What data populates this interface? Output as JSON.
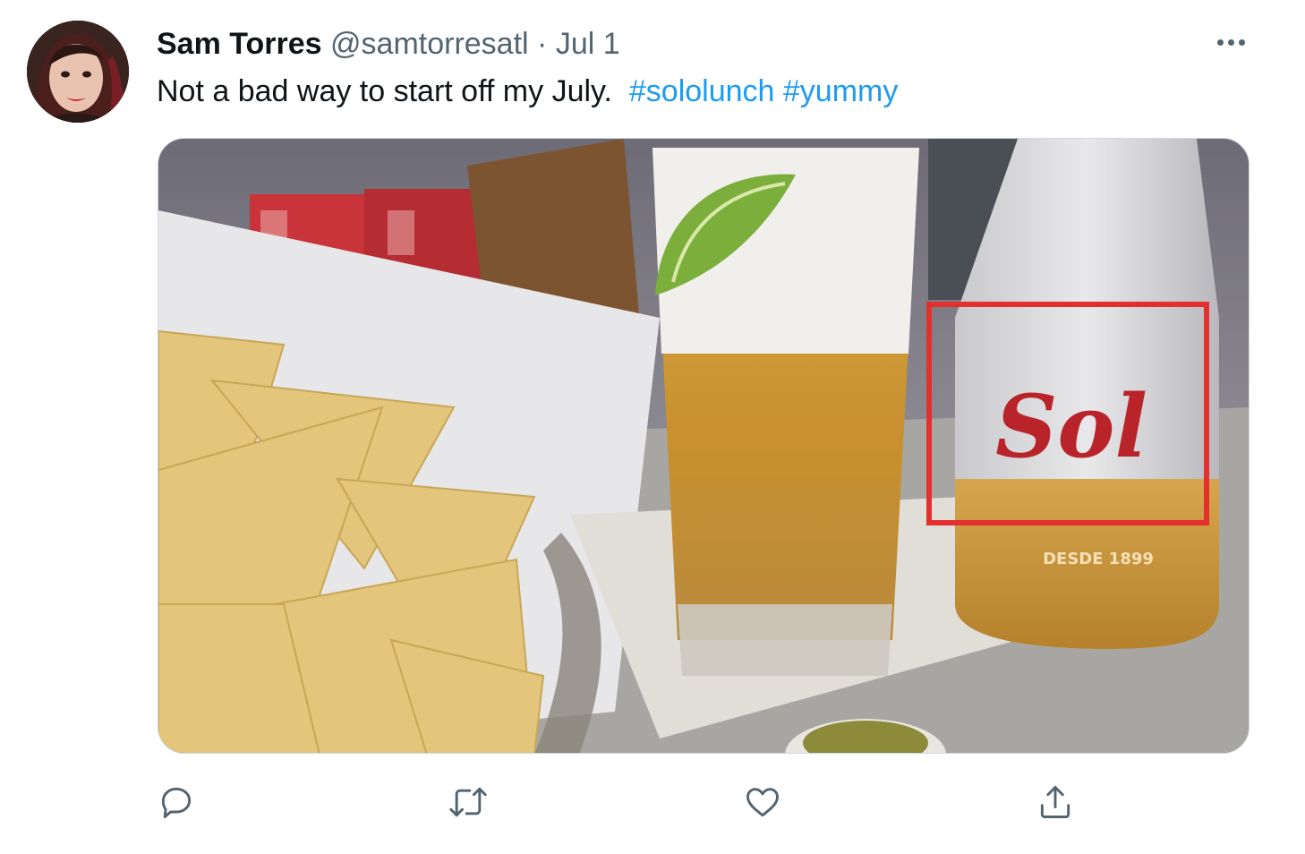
{
  "tweet": {
    "display_name": "Sam Torres",
    "handle": "@samtorresatl",
    "separator": "·",
    "date": "Jul 1",
    "text": "Not a bad way to start off my July.",
    "hashtags": [
      "#sololunch",
      "#yummy"
    ]
  },
  "media": {
    "bottle_brand": "Sol",
    "bottle_tagline": "DESDE 1899",
    "highlight_color": "#e3302f"
  },
  "icons": {
    "more": "more-options-icon",
    "reply": "reply-icon",
    "retweet": "retweet-icon",
    "like": "like-icon",
    "share": "share-icon"
  },
  "colors": {
    "text": "#0f1419",
    "muted": "#536471",
    "link": "#1d9bf0"
  }
}
